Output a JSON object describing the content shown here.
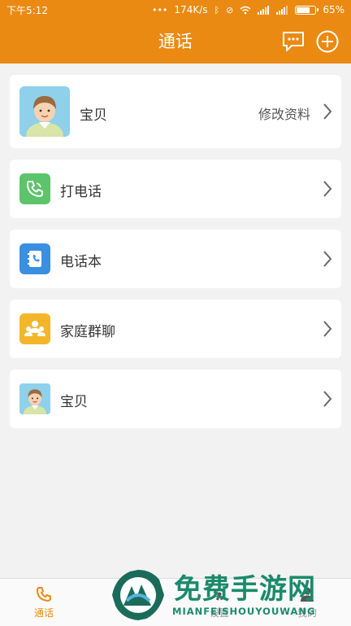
{
  "status_bar": {
    "time": "下午5:12",
    "net_speed": "174K/s",
    "battery": "65%",
    "battery_level": 0.65
  },
  "header": {
    "title": "通话",
    "icons": [
      "chat-icon",
      "add-icon"
    ]
  },
  "profile": {
    "name": "宝贝",
    "edit_label": "修改资料"
  },
  "menu": {
    "call_label": "打电话",
    "phonebook_label": "电话本",
    "family_chat_label": "家庭群聊",
    "baby_label": "宝贝"
  },
  "bottom_nav": {
    "tab_call": "通话",
    "tab_2": "",
    "tab_settings": "设置",
    "tab_mine": "我的"
  },
  "watermark": {
    "text": "免费手游网",
    "subtext": "MIANFEISHOUYOUWANG"
  },
  "colors": {
    "header": "#ea8a12",
    "call_icon_bg": "#5cc46a",
    "phonebook_icon_bg": "#3a8fe0",
    "family_icon_bg": "#f3b62a",
    "avatar_bg": "#8fd0ea"
  }
}
